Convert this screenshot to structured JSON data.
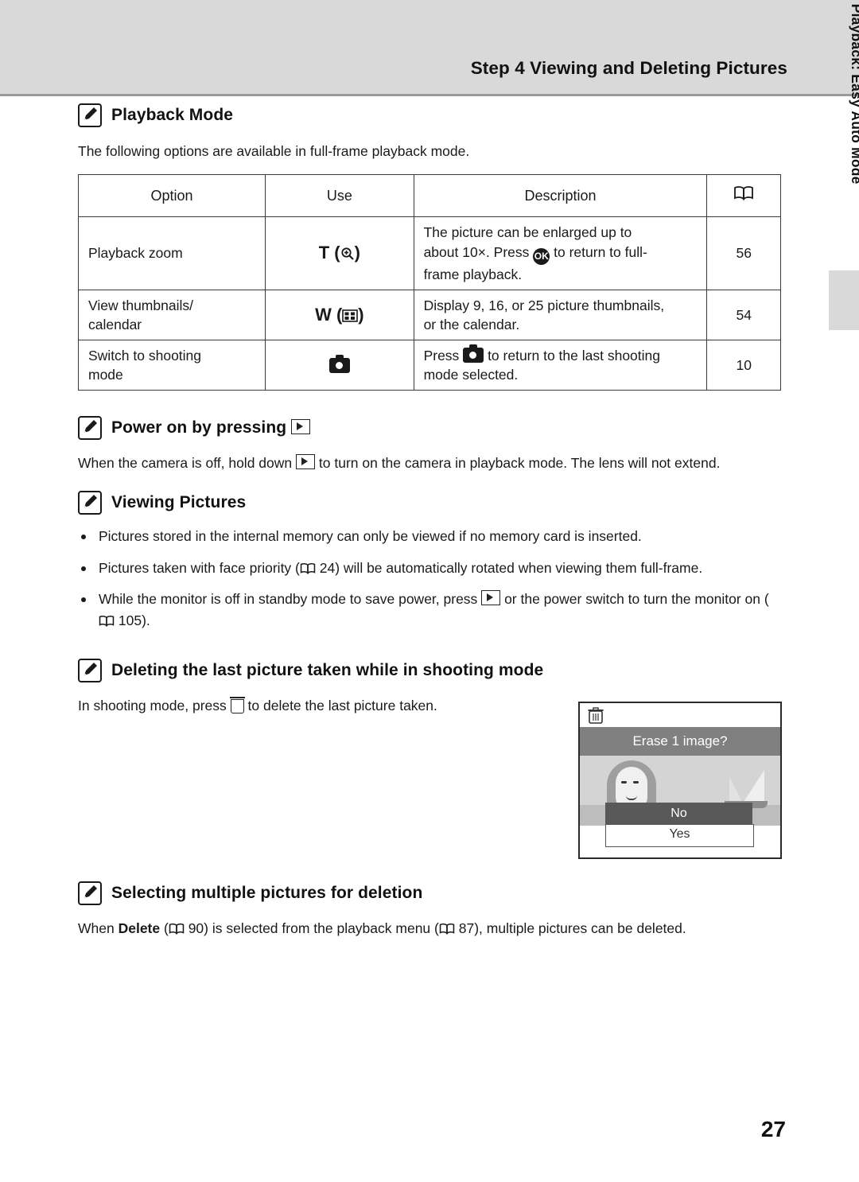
{
  "header": {
    "chapter_title": "Step 4 Viewing and Deleting Pictures"
  },
  "side_tab": {
    "label": "Basic Photography and Playback: Easy Auto Mode"
  },
  "sections": [
    {
      "id": "playback-mode",
      "icon": "pencil-note-icon",
      "title": "Playback Mode",
      "intro": "The following options are available in full-frame playback mode."
    },
    {
      "id": "power-on",
      "icon": "pencil-note-icon",
      "title": "Power on by pressing",
      "title_suffix_icon": "playback-button-icon",
      "body_1": "When the camera is off, hold down",
      "body_2": "to turn on the camera in playback mode. The lens will not extend."
    },
    {
      "id": "viewing-pictures",
      "icon": "pencil-note-icon",
      "title": "Viewing Pictures",
      "bullets": [
        "Pictures stored in the internal memory can only be viewed if no memory card is inserted.",
        "Pictures taken with face priority (A 24) will be automatically rotated when viewing them full-frame.",
        "While the monitor is off in standby mode to save power, press E or the power switch to turn the monitor on (A 105)."
      ],
      "bullet2_pre": "Pictures taken with face priority (",
      "bullet2_page": "24",
      "bullet2_post": ") will be automatically rotated when viewing them full-frame.",
      "bullet3_pre": "While the monitor is off in standby mode to save power, press",
      "bullet3_mid": "or the power switch to turn the monitor on (",
      "bullet3_page": "105",
      "bullet3_post": ")."
    },
    {
      "id": "deleting-last-picture",
      "icon": "pencil-note-icon",
      "title": "Deleting the last picture taken while in shooting mode",
      "body_pre": "In shooting mode, press",
      "body_post": "to delete the last picture taken."
    },
    {
      "id": "selecting-multiple",
      "icon": "pencil-note-icon",
      "title": "Selecting multiple pictures for deletion",
      "body_pre": "When",
      "body_bold": "Delete",
      "body_mid1": "(",
      "body_page1": "90",
      "body_mid2": ") is selected from the playback menu (",
      "body_page2": "87",
      "body_post": "), multiple pictures can be deleted."
    }
  ],
  "table": {
    "headers": {
      "option": "Option",
      "use": "Use",
      "description": "Description",
      "page": "book-icon"
    },
    "rows": [
      {
        "option": "Playback zoom",
        "use_key": "T",
        "use_icon": "magnifier-plus-icon",
        "description_1": "The picture can be enlarged up to",
        "description_2_pre": "about 10×. Press",
        "description_2_icon": "ok-button-icon",
        "description_2_post": "to return to full-",
        "description_3": "frame playback.",
        "page": "56"
      },
      {
        "option_1": "View thumbnails/",
        "option_2": "calendar",
        "use_key": "W",
        "use_icon": "thumbnail-grid-icon",
        "description_1": "Display 9, 16, or 25 picture thumbnails,",
        "description_2": "or the calendar.",
        "page": "54"
      },
      {
        "option_1": "Switch to shooting",
        "option_2": "mode",
        "use_icon": "camera-mode-icon",
        "description_1_pre": "Press",
        "description_1_icon": "camera-mode-icon",
        "description_1_post": "to return to the last shooting",
        "description_2": "mode selected.",
        "page": "10"
      }
    ]
  },
  "camera_screen": {
    "trash_icon": "trash-icon",
    "prompt": "Erase 1 image?",
    "option_no": "No",
    "option_yes": "Yes"
  },
  "footer": {
    "page_number": "27"
  }
}
